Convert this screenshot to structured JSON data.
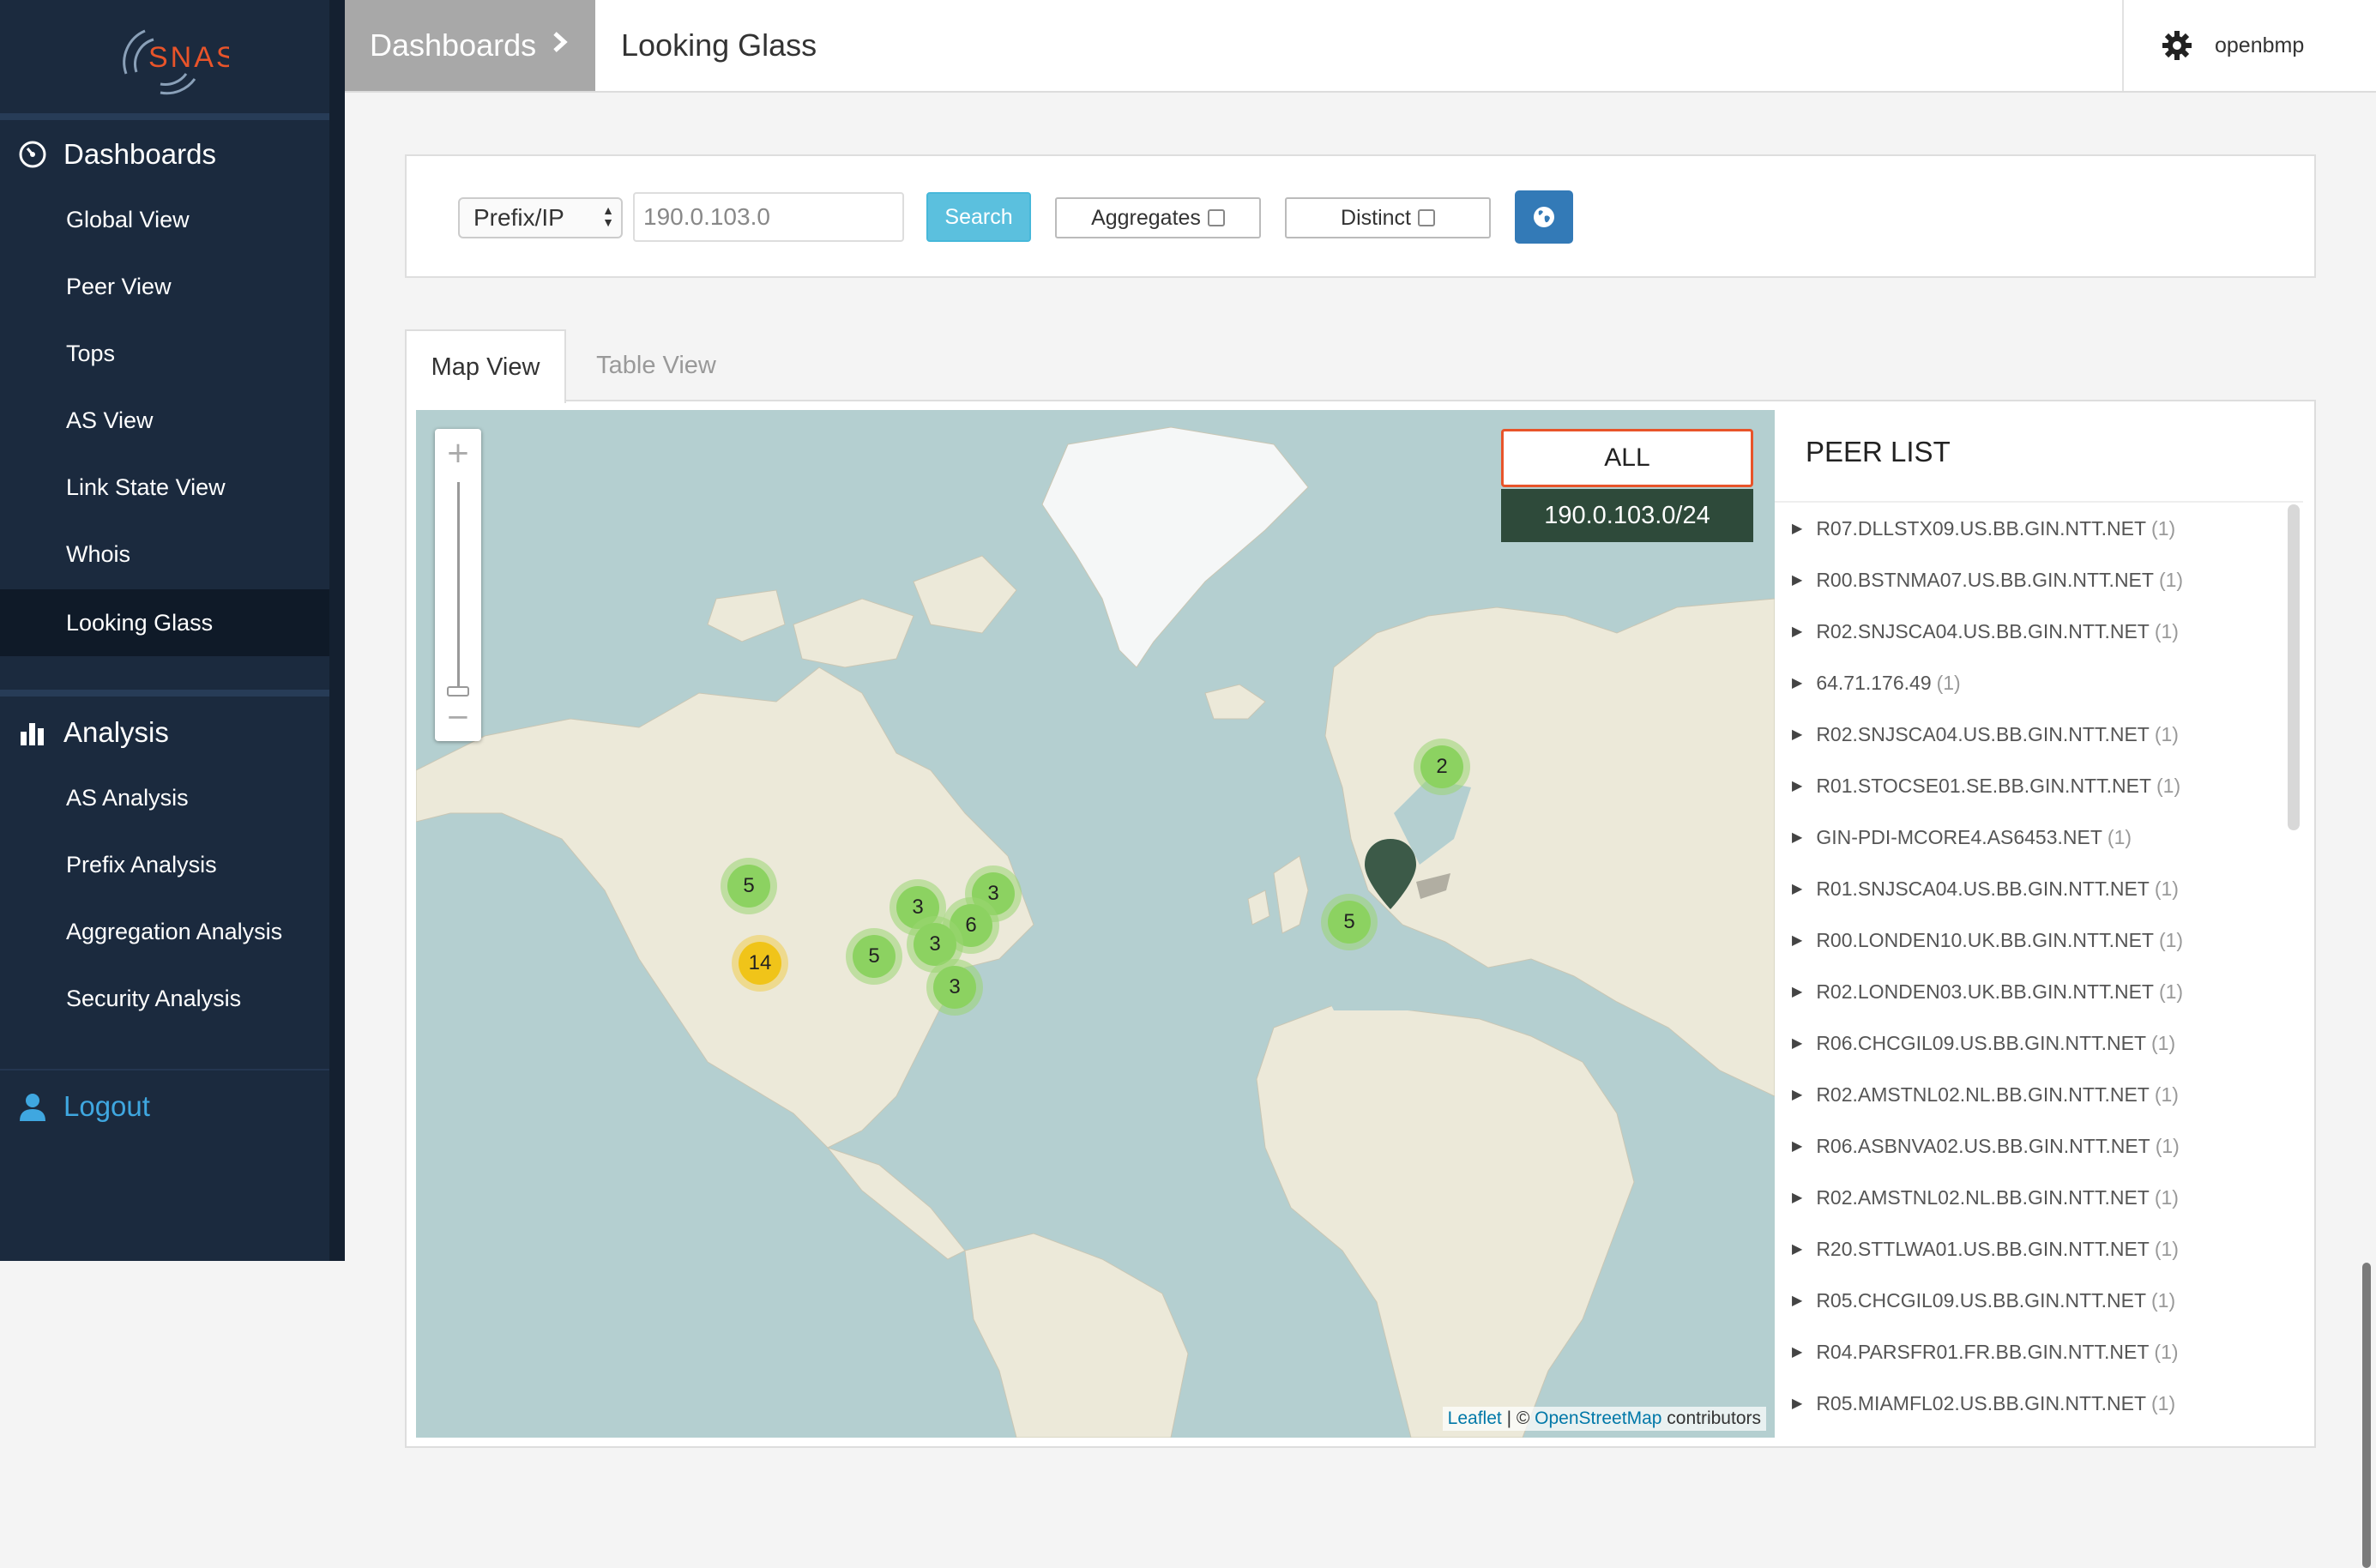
{
  "app": {
    "logo_text": "SNAS",
    "brand_color": "#e8542a"
  },
  "sidebar": {
    "sections": [
      {
        "label": "Dashboards",
        "icon": "dashboard-icon"
      },
      {
        "label": "Analysis",
        "icon": "bar-chart-icon"
      }
    ],
    "dashboards_items": [
      "Global View",
      "Peer View",
      "Tops",
      "AS View",
      "Link State View",
      "Whois",
      "Looking Glass"
    ],
    "analysis_items": [
      "AS Analysis",
      "Prefix Analysis",
      "Aggregation Analysis",
      "Security Analysis"
    ],
    "active_item": "Looking Glass",
    "logout_label": "Logout"
  },
  "header": {
    "breadcrumb": "Dashboards",
    "title": "Looking Glass",
    "username": "openbmp"
  },
  "search": {
    "type_selected": "Prefix/IP",
    "value": "190.0.103.0",
    "search_label": "Search",
    "aggregates_label": "Aggregates",
    "aggregates_checked": false,
    "distinct_label": "Distinct",
    "distinct_checked": false,
    "globe_icon": "globe-icon"
  },
  "tabs": [
    {
      "label": "Map View",
      "active": true
    },
    {
      "label": "Table View",
      "active": false
    }
  ],
  "map": {
    "zoom_in": "+",
    "zoom_out": "−",
    "overlay_all": "ALL",
    "overlay_prefix": "190.0.103.0/24",
    "clusters": [
      {
        "count": "2",
        "color": "green"
      },
      {
        "count": "5",
        "color": "green"
      },
      {
        "count": "14",
        "color": "yellow"
      },
      {
        "count": "3",
        "color": "green"
      },
      {
        "count": "3",
        "color": "green"
      },
      {
        "count": "6",
        "color": "green"
      },
      {
        "count": "3",
        "color": "green"
      },
      {
        "count": "5",
        "color": "green"
      },
      {
        "count": "3",
        "color": "green"
      },
      {
        "count": "5",
        "color": "green"
      }
    ],
    "attribution": {
      "leaflet": "Leaflet",
      "sep": " | © ",
      "osm": "OpenStreetMap",
      "tail": " contributors"
    }
  },
  "peer_list": {
    "title": "PEER LIST",
    "peers": [
      {
        "name": "R07.DLLSTX09.US.BB.GIN.NTT.NET",
        "count": "(1)"
      },
      {
        "name": "R00.BSTNMA07.US.BB.GIN.NTT.NET",
        "count": "(1)"
      },
      {
        "name": "R02.SNJSCA04.US.BB.GIN.NTT.NET",
        "count": "(1)"
      },
      {
        "name": "64.71.176.49",
        "count": "(1)"
      },
      {
        "name": "R02.SNJSCA04.US.BB.GIN.NTT.NET",
        "count": "(1)"
      },
      {
        "name": "R01.STOCSE01.SE.BB.GIN.NTT.NET",
        "count": "(1)"
      },
      {
        "name": "GIN-PDI-MCORE4.AS6453.NET",
        "count": "(1)"
      },
      {
        "name": "R01.SNJSCA04.US.BB.GIN.NTT.NET",
        "count": "(1)"
      },
      {
        "name": "R00.LONDEN10.UK.BB.GIN.NTT.NET",
        "count": "(1)"
      },
      {
        "name": "R02.LONDEN03.UK.BB.GIN.NTT.NET",
        "count": "(1)"
      },
      {
        "name": "R06.CHCGIL09.US.BB.GIN.NTT.NET",
        "count": "(1)"
      },
      {
        "name": "R02.AMSTNL02.NL.BB.GIN.NTT.NET",
        "count": "(1)"
      },
      {
        "name": "R06.ASBNVA02.US.BB.GIN.NTT.NET",
        "count": "(1)"
      },
      {
        "name": "R02.AMSTNL02.NL.BB.GIN.NTT.NET",
        "count": "(1)"
      },
      {
        "name": "R20.STTLWA01.US.BB.GIN.NTT.NET",
        "count": "(1)"
      },
      {
        "name": "R05.CHCGIL09.US.BB.GIN.NTT.NET",
        "count": "(1)"
      },
      {
        "name": "R04.PARSFR01.FR.BB.GIN.NTT.NET",
        "count": "(1)"
      },
      {
        "name": "R05.MIAMFL02.US.BB.GIN.NTT.NET",
        "count": "(1)"
      }
    ]
  }
}
